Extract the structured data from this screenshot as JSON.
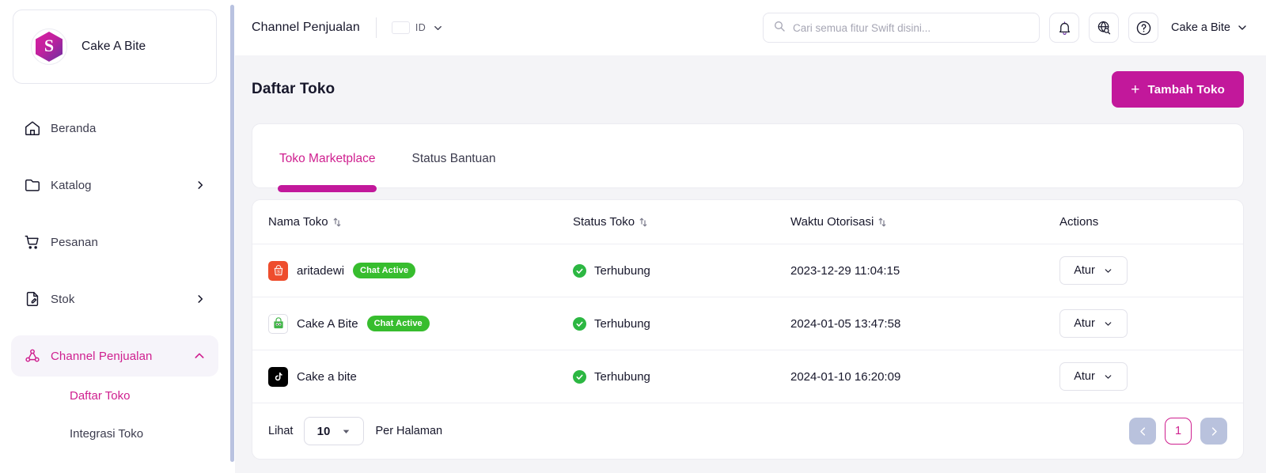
{
  "sidebar": {
    "brand": {
      "name": "Cake A Bite",
      "logo_letter": "S",
      "logo_icon": "swift-hexagon-logo"
    },
    "items": [
      {
        "label": "Beranda",
        "icon": "home-icon",
        "expandable": false
      },
      {
        "label": "Katalog",
        "icon": "folder-icon",
        "expandable": true
      },
      {
        "label": "Pesanan",
        "icon": "cart-icon",
        "expandable": false
      },
      {
        "label": "Stok",
        "icon": "document-edit-icon",
        "expandable": true
      },
      {
        "label": "Channel Penjualan",
        "icon": "network-icon",
        "expandable": true,
        "active": true
      }
    ],
    "subitems": [
      {
        "label": "Daftar Toko",
        "active": true
      },
      {
        "label": "Integrasi Toko",
        "active": false
      }
    ]
  },
  "topbar": {
    "title": "Channel Penjualan",
    "language": {
      "code": "ID",
      "flag": "indonesia-flag"
    },
    "search": {
      "placeholder": "Cari semua fitur Swift disini...",
      "value": ""
    },
    "icons": [
      "bell-icon",
      "globe-search-icon",
      "help-circle-icon"
    ],
    "user": "Cake a Bite"
  },
  "page": {
    "title": "Daftar Toko",
    "add_button": "Tambah Toko",
    "add_button_color": "#c2189b"
  },
  "tabs": [
    {
      "label": "Toko Marketplace",
      "active": true
    },
    {
      "label": "Status Bantuan",
      "active": false
    }
  ],
  "table": {
    "columns": [
      {
        "label": "Nama Toko",
        "sortable": true
      },
      {
        "label": "Status Toko",
        "sortable": true
      },
      {
        "label": "Waktu Otorisasi",
        "sortable": true
      },
      {
        "label": "Actions",
        "sortable": false
      }
    ],
    "rows": [
      {
        "store_name": "aritadewi",
        "marketplace": "shopee",
        "badge": "Chat Active",
        "status": "Terhubung",
        "time": "2023-12-29 11:04:15",
        "action": "Atur"
      },
      {
        "store_name": "Cake A Bite",
        "marketplace": "tokopedia",
        "badge": "Chat Active",
        "status": "Terhubung",
        "time": "2024-01-05 13:47:58",
        "action": "Atur"
      },
      {
        "store_name": "Cake a bite",
        "marketplace": "tiktok",
        "badge": "",
        "status": "Terhubung",
        "time": "2024-01-10 16:20:09",
        "action": "Atur"
      }
    ]
  },
  "footer": {
    "lihat_label": "Lihat",
    "per_page_value": "10",
    "per_halaman_label": "Per Halaman",
    "current_page": "1",
    "prev_icon": "chevron-left-icon",
    "next_icon": "chevron-right-icon"
  },
  "colors": {
    "accent": "#cf1f8f",
    "accent_strong": "#c2189b",
    "status_green": "#2cb742",
    "badge_green": "#37bd2e"
  }
}
